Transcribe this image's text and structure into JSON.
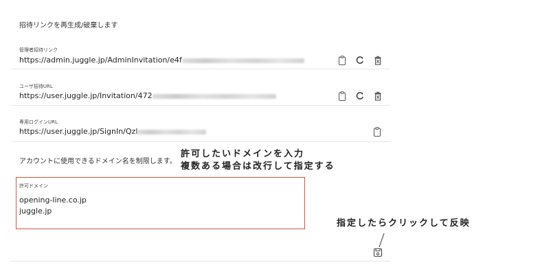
{
  "page": {
    "heading": "招待リンクを再生成/破棄します"
  },
  "links": [
    {
      "label": "管理者招待リンク",
      "url_prefix": "https://admin.juggle.jp/AdminInvitation/e4f",
      "actions": [
        "copy",
        "regenerate",
        "delete"
      ]
    },
    {
      "label": "ユーザ招待URL",
      "url_prefix": "https://user.juggle.jp/Invitation/472",
      "actions": [
        "copy",
        "regenerate",
        "delete"
      ]
    },
    {
      "label": "専用ログインURL",
      "url_prefix": "https://user.juggle.jp/SignIn/Qzl",
      "actions": [
        "copy"
      ]
    }
  ],
  "domain_section": {
    "description": "アカウントに使用できるドメイン名を制限します。",
    "field_label": "許可ドメイン",
    "domains_text": "opening-line.co.jp\njuggle.jp"
  },
  "annotations": {
    "domain_note_line1": "許可したいドメインを入力",
    "domain_note_line2": "複数ある場合は改行して指定する",
    "save_note": "指定したらクリックして反映"
  },
  "icons": {
    "copy": "clipboard-icon",
    "regenerate": "refresh-icon",
    "delete": "trash-icon",
    "save": "save-icon"
  },
  "colors": {
    "field_border": "#d2553f",
    "divider": "#e6e6e6"
  }
}
